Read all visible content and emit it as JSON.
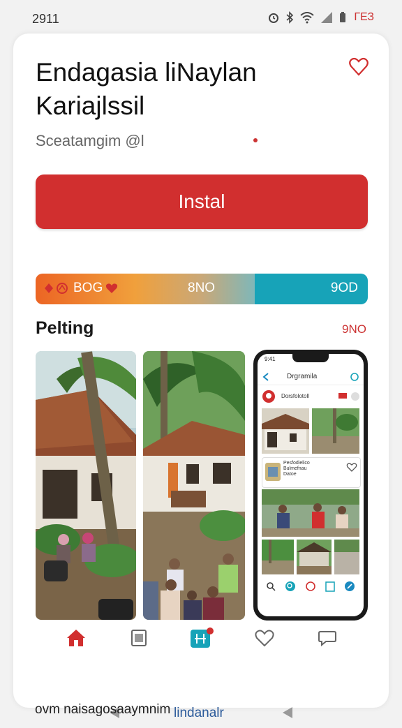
{
  "status": {
    "time": "2911",
    "battery": "ГЕЗ"
  },
  "app": {
    "title": "Endagasia liNaylan Kariajlssil",
    "developer": "Sceatamgim @l",
    "install_label": "Instal",
    "accent": "#d12f2f"
  },
  "stats": {
    "rating": "BOG",
    "downloads": "8NO",
    "age": "9OD"
  },
  "screenshots": {
    "title": "Pelting",
    "more": "9NO",
    "phone": {
      "time": "9:41",
      "title": "Drgramila",
      "row_text": "Dorsfolotoll",
      "card_text": "Pesfodielico\nBulmefnau\nDatoe"
    }
  },
  "nav": [
    "home-icon",
    "apps-icon",
    "updates-icon",
    "wishlist-icon",
    "chat-icon"
  ],
  "bottom": {
    "label": "lindanalr"
  },
  "footer": {
    "text": "ovm naisagosaaymnim"
  }
}
